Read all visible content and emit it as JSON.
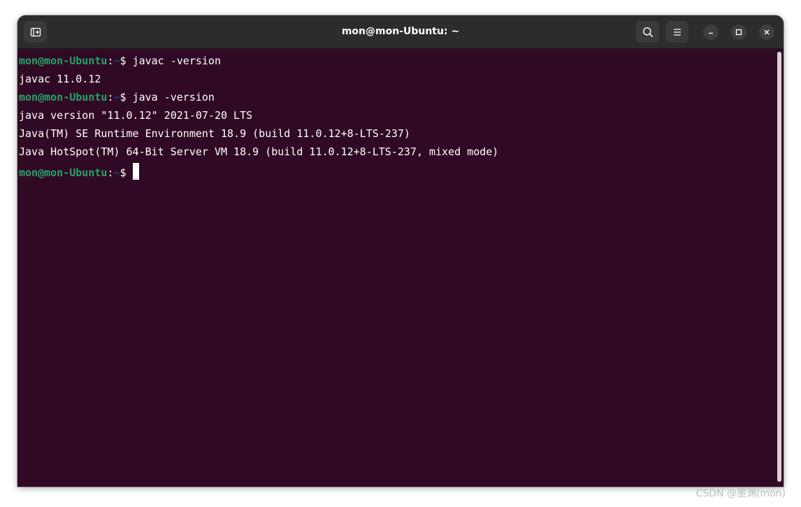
{
  "window": {
    "title": "mon@mon-Ubuntu: ~"
  },
  "titlebar": {
    "new_tab_icon": "new-tab-icon",
    "search_icon": "search-icon",
    "menu_icon": "hamburger-menu-icon",
    "minimize_icon": "minimize-icon",
    "maximize_icon": "maximize-icon",
    "close_icon": "close-icon"
  },
  "colors": {
    "terminal_bg": "#300a24",
    "prompt_user": "#26a269",
    "prompt_path": "#12488b",
    "titlebar_bg": "#2c2c2c"
  },
  "terminal": {
    "lines": [
      {
        "type": "prompt",
        "user": "mon@mon-Ubuntu",
        "colon": ":",
        "path": "~",
        "dollar": "$ ",
        "command": "javac -version"
      },
      {
        "type": "output",
        "text": "javac 11.0.12"
      },
      {
        "type": "prompt",
        "user": "mon@mon-Ubuntu",
        "colon": ":",
        "path": "~",
        "dollar": "$ ",
        "command": "java -version"
      },
      {
        "type": "output",
        "text": "java version \"11.0.12\" 2021-07-20 LTS"
      },
      {
        "type": "output",
        "text": "Java(TM) SE Runtime Environment 18.9 (build 11.0.12+8-LTS-237)"
      },
      {
        "type": "output",
        "text": "Java HotSpot(TM) 64-Bit Server VM 18.9 (build 11.0.12+8-LTS-237, mixed mode)"
      },
      {
        "type": "prompt",
        "user": "mon@mon-Ubuntu",
        "colon": ":",
        "path": "~",
        "dollar": "$ ",
        "command": ""
      }
    ]
  },
  "watermark": "CSDN @墨渊(mon)"
}
